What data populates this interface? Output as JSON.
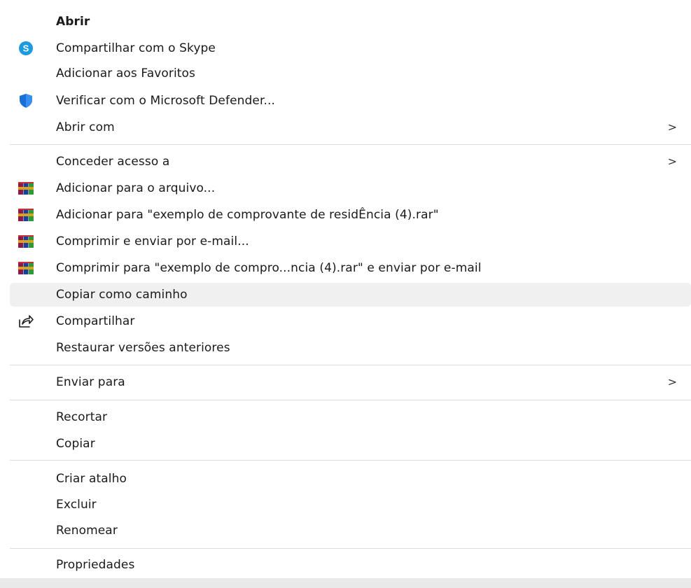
{
  "menu": {
    "items": [
      {
        "label": "Abrir"
      },
      {
        "label": "Compartilhar com o Skype"
      },
      {
        "label": "Adicionar aos Favoritos"
      },
      {
        "label": "Verificar com o Microsoft Defender..."
      },
      {
        "label": "Abrir com",
        "chevron": ">"
      },
      {
        "label": "Conceder acesso a",
        "chevron": ">"
      },
      {
        "label": "Adicionar para o arquivo..."
      },
      {
        "label": "Adicionar para \"exemplo de comprovante de residÊncia (4).rar\""
      },
      {
        "label": "Comprimir e enviar por e-mail..."
      },
      {
        "label": "Comprimir para \"exemplo de compro...ncia (4).rar\" e enviar por e-mail"
      },
      {
        "label": "Copiar como caminho"
      },
      {
        "label": "Compartilhar"
      },
      {
        "label": "Restaurar versões anteriores"
      },
      {
        "label": "Enviar para",
        "chevron": ">"
      },
      {
        "label": "Recortar"
      },
      {
        "label": "Copiar"
      },
      {
        "label": "Criar atalho"
      },
      {
        "label": "Excluir"
      },
      {
        "label": "Renomear"
      },
      {
        "label": "Propriedades"
      }
    ]
  },
  "icons": {
    "skype": "skype-icon",
    "defender": "shield-icon",
    "winrar": "winrar-icon",
    "share": "share-icon"
  },
  "colors": {
    "skype_blue": "#1e9be0",
    "defender_blue": "#1a6fd6",
    "hover_bg": "#f0f0f0",
    "separator": "#dcdcdc"
  }
}
